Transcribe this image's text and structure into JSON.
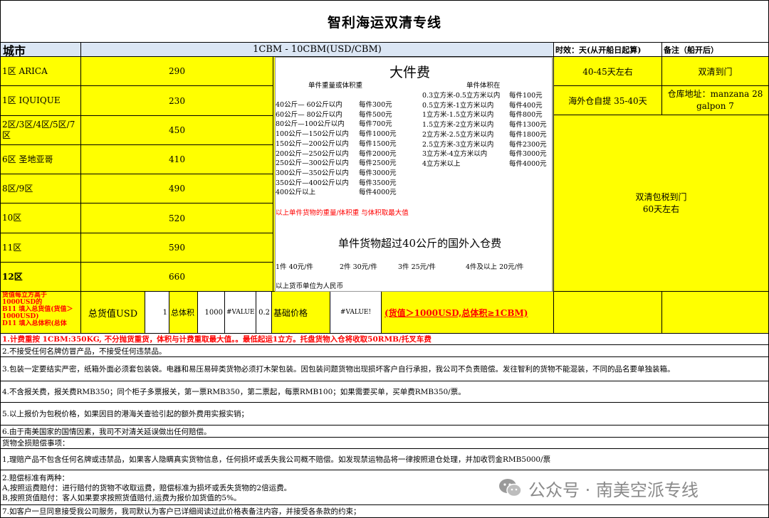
{
  "title": "智利海运双清专线",
  "header": {
    "city": "城市",
    "rate": "1CBM  -  10CBM(USD/CBM)",
    "transit": "时效：天(从开船日起算)",
    "remark": "备注（船开后）"
  },
  "rows": [
    {
      "city": "1区 ARICA",
      "price": "290"
    },
    {
      "city": "1区 IQUIQUE",
      "price": "230"
    },
    {
      "city": "2区/3区/4区/5区/7区",
      "price": "450"
    },
    {
      "city": "6区 圣地亚哥",
      "price": "410"
    },
    {
      "city": "8区/9区",
      "price": "490"
    },
    {
      "city": "10区",
      "price": "520"
    },
    {
      "city": "11区",
      "price": "590"
    },
    {
      "city": "12区",
      "price": "660"
    }
  ],
  "right": {
    "transit1": "40-45天左右",
    "remark1": "双清到门",
    "transit2": "海外仓自提 35-40天",
    "remark2": "仓库地址：manzana 28 galpon 7",
    "merged": "双清包税到门\n60天左右"
  },
  "panel": {
    "title": "大件费",
    "col1_head": "单件重量或体积重",
    "col2_head": "单件体积在",
    "weights": [
      {
        "range": "40公斤— 60公斤以内",
        "fee": "每件300元"
      },
      {
        "range": "60公斤— 80公斤以内",
        "fee": "每件500元"
      },
      {
        "range": "80公斤—100公斤以内",
        "fee": "每件700元"
      },
      {
        "range": "100公斤—150公斤以内",
        "fee": "每件1000元"
      },
      {
        "range": "150公斤—200公斤以内",
        "fee": "每件1500元"
      },
      {
        "range": "200公斤—250公斤以内",
        "fee": "每件2000元"
      },
      {
        "range": "250公斤—300公斤以内",
        "fee": "每件2500元"
      },
      {
        "range": "300公斤—350公斤以内",
        "fee": "每件3000元"
      },
      {
        "range": "350公斤—400公斤以内",
        "fee": "每件3500元"
      },
      {
        "range": "400公斤以上",
        "fee": "每件4000元"
      }
    ],
    "volumes": [
      {
        "range": "0.3立方米-0.5立方米以内",
        "fee": "每件100元"
      },
      {
        "range": "0.5立方米-1立方米以内",
        "fee": "每件400元"
      },
      {
        "range": "1立方米-1.5立方米以内",
        "fee": "每件800元"
      },
      {
        "range": "1.5立方米-2立方米以内",
        "fee": "每件1300元"
      },
      {
        "range": "2立方米-2.5立方米以内",
        "fee": "每件1800元"
      },
      {
        "range": "2.5立方米-3立方米以内",
        "fee": "每件2300元"
      },
      {
        "range": "3立方米-4立方米以内",
        "fee": "每件3000元"
      },
      {
        "range": "4立方米以上",
        "fee": "每件4000元"
      }
    ],
    "red_note": "以上单件货物的重量/体积重  与体积取最大值",
    "subtitle": "单件货物超过40公斤的国外入仓费",
    "warehouse": [
      "1件 40元/件",
      "2件 30元/件",
      "3件 25元/件",
      "4件及以上 20元/件"
    ],
    "currency": "以上货币单位为人民币"
  },
  "calc": {
    "red_text": "货值每立方高于1000USD的\nB11 填入总货值(货值＞1000USD)\nD11 填入总体积(总体",
    "total_label": "总货值USD",
    "total_value": "1",
    "vol_label": "总体积",
    "vol_value": "1000",
    "err1": "#VALUE!",
    "num": "0.2",
    "base_label": "基础价格",
    "err2": "#VALUE!",
    "condition": "(货值＞1000USD,总体积≥1CBM)"
  },
  "notes": [
    "1.计费重按  1CBM:350KG, 不分抛货重货，体积与计费重取最大值。。最低起运1立方。托盘货物入仓将收取50RMB/托叉车费",
    "2.不接受任何名牌仿冒产品，不接受任何违禁品。",
    "3.包装一定要结实严密，纸箱外面必须套包装袋。电器和易压易碎类货物必须打木架包装。因包装问题货物出现损坏客户自行承担，我公司不负责赔偿。发往智利的货物不能混装，不同的品名要单独装箱。",
    "4.不含报关费，报关费RMB350；同个柜子多票报关，第一票RMB350，第二票起，每票RMB100；如果需要买单，买单费RMB350/票。",
    "5.以上报价为包税价格，如果因目的港海关查验引起的额外费用实报实销；",
    "6.由于南美国家的国情因素，我司不对清关延误做出任何赔偿。",
    "货物全损赔偿事项：",
    "1,理赔产品不包含任何名牌或违禁品，如果客人隐瞒真实货物信息，任何损坏或丢失我公司概不赔偿。如发现禁运物品将一律按照退仓处理，并加收罚金RMB5000/票",
    "2.赔偿标准有两种：",
    "A,按照运费赔付：进行赔付的货物不收取运费，赔偿标准为损坏或丢失货物的2倍运费。",
    "B,按照货值赔付：客人如果要求按照货值赔付,运费为报价加货值的5%。",
    "7.如客户一旦同意接受我公司服务，我司默认为客户已详细阅读过此价格表备注内容，并接受各条款的约束；"
  ],
  "watermark": "公众号 · 南美空派专线",
  "watermark_icon": "wechat-icon",
  "colors": {
    "yellow": "#ffff00",
    "header_blue": "#dbe6f4",
    "red": "#ff0000"
  }
}
